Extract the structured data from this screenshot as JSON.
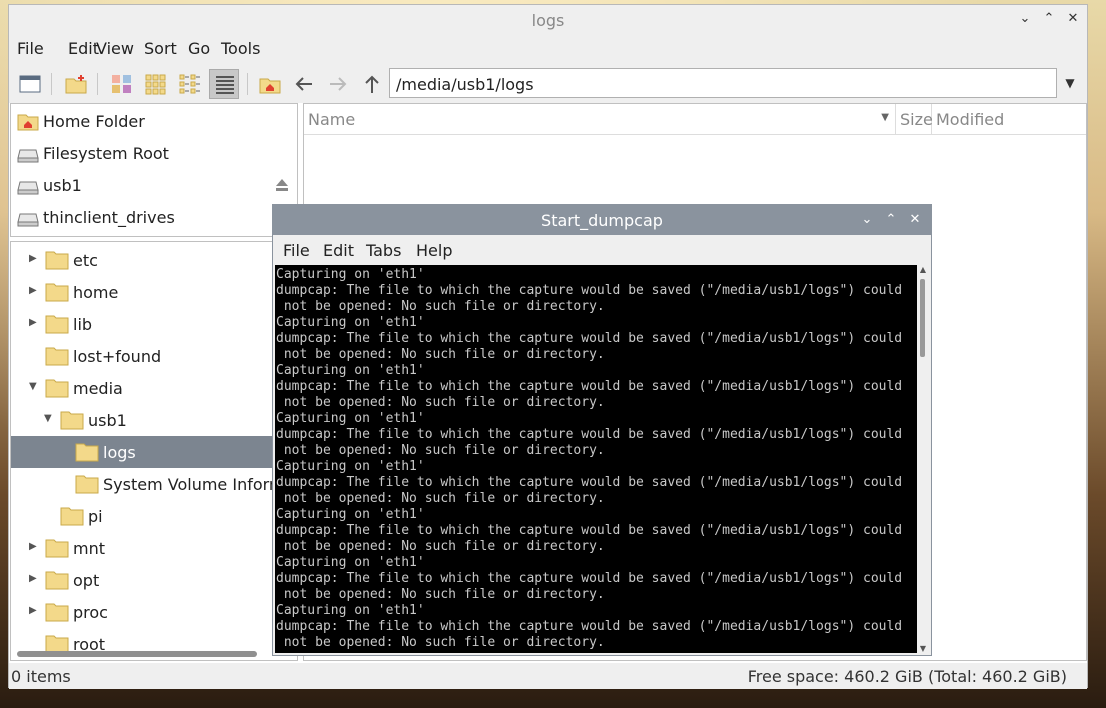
{
  "file_manager": {
    "title": "logs",
    "menu": [
      "File",
      "Edit",
      "View",
      "Sort",
      "Go",
      "Tools"
    ],
    "path": "/media/usb1/logs",
    "places": [
      {
        "label": "Home Folder",
        "icon": "home-icon"
      },
      {
        "label": "Filesystem Root",
        "icon": "drive-icon"
      },
      {
        "label": "usb1",
        "icon": "drive-icon"
      },
      {
        "label": "thinclient_drives",
        "icon": "drive-icon"
      }
    ],
    "tree": [
      {
        "label": "etc",
        "expander": "right"
      },
      {
        "label": "home",
        "expander": "right"
      },
      {
        "label": "lib",
        "expander": "right"
      },
      {
        "label": "lost+found",
        "expander": ""
      },
      {
        "label": "media",
        "expander": "down"
      },
      {
        "label": "usb1",
        "expander": "down"
      },
      {
        "label": "logs",
        "expander": "",
        "selected": true
      },
      {
        "label": "System Volume Informa",
        "expander": ""
      },
      {
        "label": "pi",
        "expander": ""
      },
      {
        "label": "mnt",
        "expander": "right"
      },
      {
        "label": "opt",
        "expander": "right"
      },
      {
        "label": "proc",
        "expander": "right"
      },
      {
        "label": "root",
        "expander": ""
      }
    ],
    "columns": {
      "name": "Name",
      "size": "Size",
      "modified": "Modified"
    },
    "status": {
      "items": "0 items",
      "free": "Free space: 460.2 GiB (Total: 460.2 GiB)"
    }
  },
  "terminal": {
    "title": "Start_dumpcap",
    "menu": [
      "File",
      "Edit",
      "Tabs",
      "Help"
    ],
    "output": "Capturing on 'eth1'\ndumpcap: The file to which the capture would be saved (\"/media/usb1/logs\") could\n not be opened: No such file or directory.\nCapturing on 'eth1'\ndumpcap: The file to which the capture would be saved (\"/media/usb1/logs\") could\n not be opened: No such file or directory.\nCapturing on 'eth1'\ndumpcap: The file to which the capture would be saved (\"/media/usb1/logs\") could\n not be opened: No such file or directory.\nCapturing on 'eth1'\ndumpcap: The file to which the capture would be saved (\"/media/usb1/logs\") could\n not be opened: No such file or directory.\nCapturing on 'eth1'\ndumpcap: The file to which the capture would be saved (\"/media/usb1/logs\") could\n not be opened: No such file or directory.\nCapturing on 'eth1'\ndumpcap: The file to which the capture would be saved (\"/media/usb1/logs\") could\n not be opened: No such file or directory.\nCapturing on 'eth1'\ndumpcap: The file to which the capture would be saved (\"/media/usb1/logs\") could\n not be opened: No such file or directory.\nCapturing on 'eth1'\ndumpcap: The file to which the capture would be saved (\"/media/usb1/logs\") could\n not be opened: No such file or directory."
  },
  "colors": {
    "selection": "#7c8590",
    "terminal_titlebar": "#8a939e",
    "folder": "#f3d98a"
  }
}
